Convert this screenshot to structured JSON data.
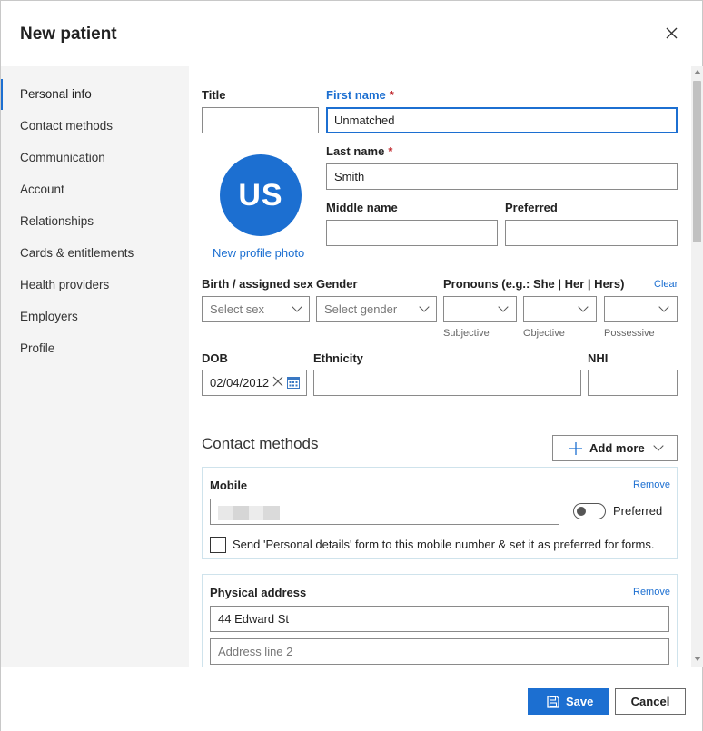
{
  "dialog": {
    "title": "New patient"
  },
  "nav": {
    "items": [
      {
        "label": "Personal info"
      },
      {
        "label": "Contact methods"
      },
      {
        "label": "Communication"
      },
      {
        "label": "Account"
      },
      {
        "label": "Relationships"
      },
      {
        "label": "Cards & entitlements"
      },
      {
        "label": "Health providers"
      },
      {
        "label": "Employers"
      },
      {
        "label": "Profile"
      }
    ],
    "active": "Personal info"
  },
  "form": {
    "title_label": "Title",
    "title_value": "",
    "first_name_label": "First name",
    "first_name_value": "Unmatched",
    "last_name_label": "Last name",
    "last_name_value": "Smith",
    "required_mark": "*",
    "middle_name_label": "Middle name",
    "middle_name_value": "",
    "preferred_label": "Preferred",
    "preferred_value": "",
    "avatar_initials": "US",
    "new_photo_link": "New profile photo",
    "sex_label": "Birth / assigned sex",
    "sex_placeholder": "Select sex",
    "gender_label": "Gender",
    "gender_placeholder": "Select gender",
    "pronouns_label": "Pronouns (e.g.: She | Her | Hers)",
    "pronouns_clear": "Clear",
    "pronoun_subjective": "Subjective",
    "pronoun_objective": "Objective",
    "pronoun_possessive": "Possessive",
    "dob_label": "DOB",
    "dob_value": "02/04/2012",
    "ethnicity_label": "Ethnicity",
    "nhi_label": "NHI"
  },
  "contact": {
    "section_title": "Contact methods",
    "add_more": "Add more",
    "mobile_label": "Mobile",
    "mobile_remove": "Remove",
    "preferred_toggle_label": "Preferred",
    "preferred_toggle_on": false,
    "send_form_text": "Send 'Personal details' form to this mobile number & set it as preferred for forms.",
    "address_label": "Physical address",
    "address_remove": "Remove",
    "address_line1": "44 Edward St",
    "address_line2_placeholder": "Address line 2"
  },
  "footer": {
    "save": "Save",
    "cancel": "Cancel"
  },
  "colors": {
    "accent": "#1c6fd1",
    "required": "#c0272d"
  }
}
